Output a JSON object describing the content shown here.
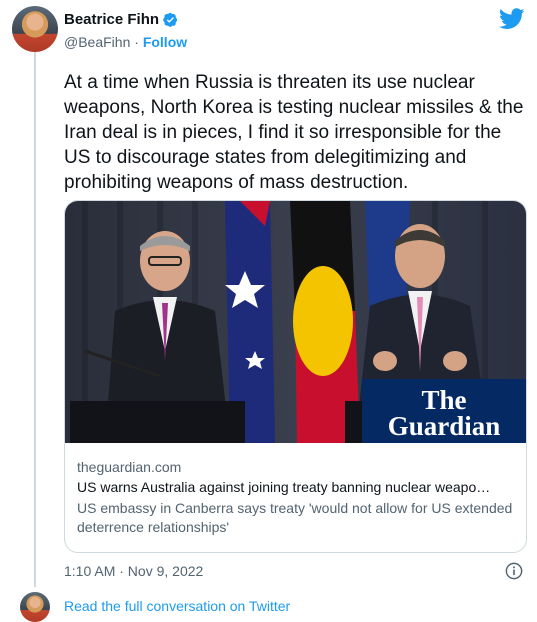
{
  "author": {
    "name": "Beatrice Fihn",
    "handle": "@BeaFihn",
    "separator": "·",
    "follow_label": "Follow"
  },
  "tweet": {
    "text": "At a time when Russia is threaten its use nuclear weapons, North Korea is testing nuclear missiles & the Iran deal is in pieces, I find it so irresponsible for the US to discourage states from delegitimizing and prohibiting weapons of mass destruction.",
    "timestamp": "1:10 AM · Nov 9, 2022"
  },
  "card": {
    "domain": "theguardian.com",
    "title": "US warns Australia against joining treaty banning nuclear weapo…",
    "description": "US embassy in Canberra says treaty 'would not allow for US extended deterrence relationships'",
    "logo_line1": "The",
    "logo_line2": "Guardian"
  },
  "footer": {
    "read_label": "Read the full conversation on Twitter"
  },
  "colors": {
    "accent": "#1d9bf0",
    "text": "#0f1419",
    "secondary": "#536471",
    "border": "#cfd9de",
    "guardian_blue": "#052962"
  },
  "icons": [
    "verified-badge-icon",
    "twitter-bird-icon",
    "info-icon"
  ]
}
